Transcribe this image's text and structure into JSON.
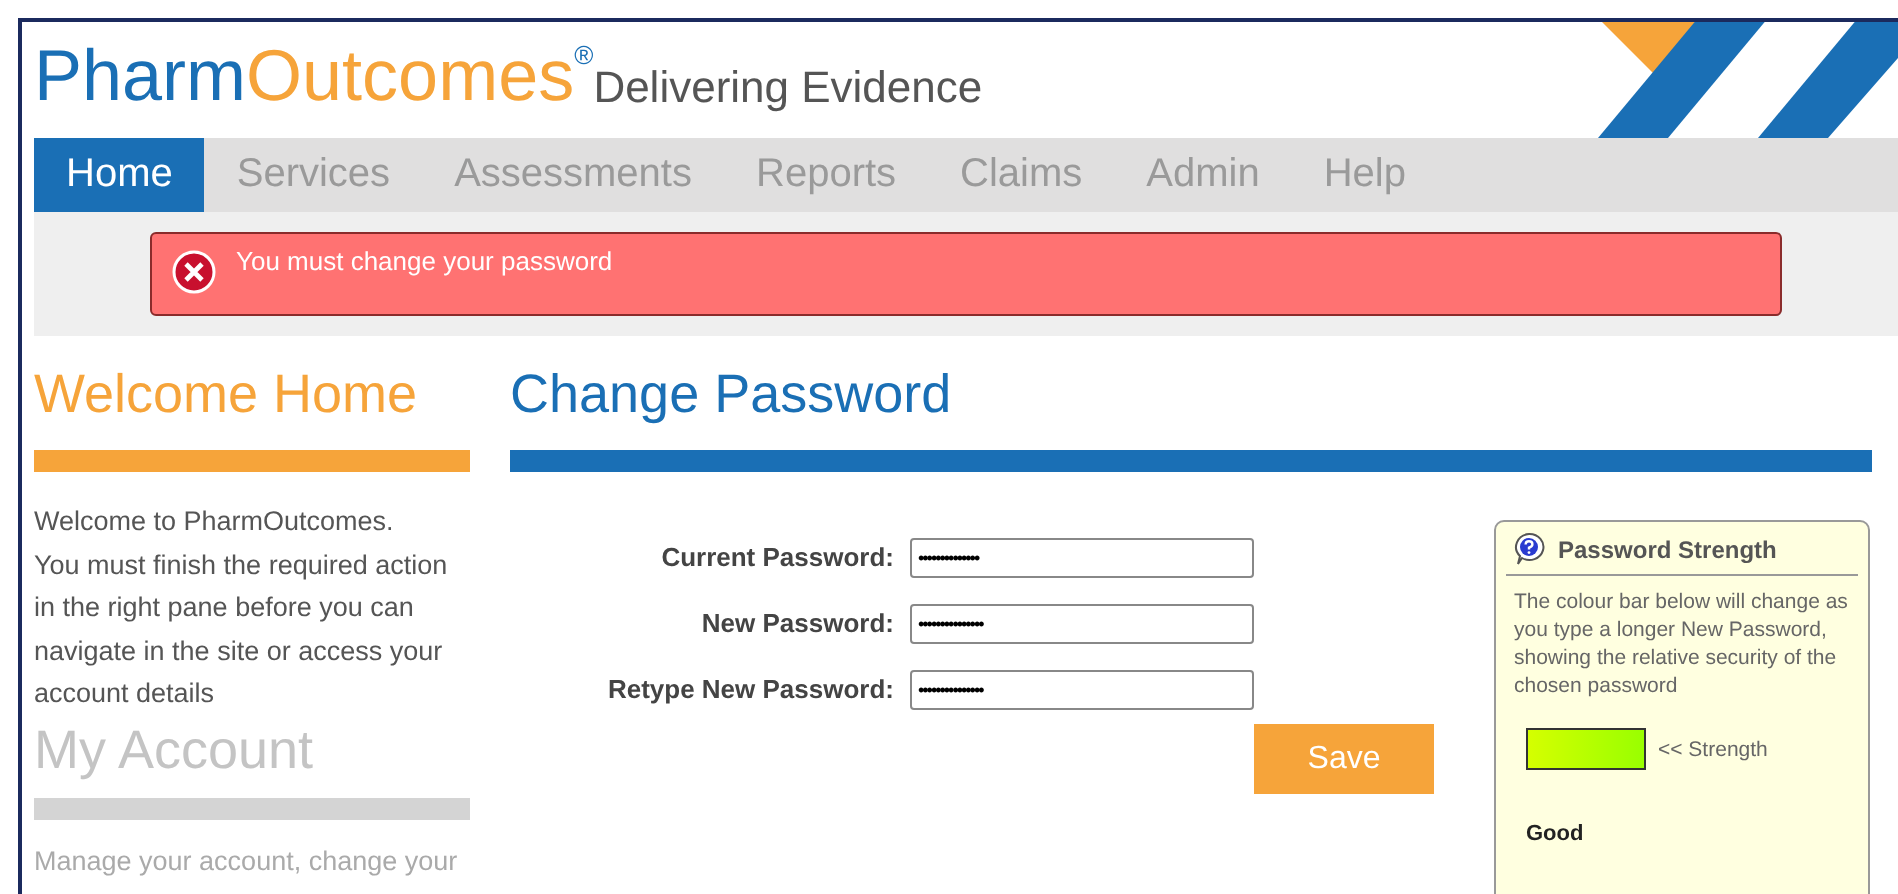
{
  "logo": {
    "name_first": "Pharm",
    "name_second": "Outcomes",
    "registered": "®",
    "tagline": "Delivering Evidence"
  },
  "nav": [
    {
      "label": "Home",
      "selected": true,
      "disabled": false
    },
    {
      "label": "Services",
      "selected": false,
      "disabled": true
    },
    {
      "label": "Assessments",
      "selected": false,
      "disabled": true
    },
    {
      "label": "Reports",
      "selected": false,
      "disabled": true
    },
    {
      "label": "Claims",
      "selected": false,
      "disabled": true
    },
    {
      "label": "Admin",
      "selected": false,
      "disabled": true
    },
    {
      "label": "Help",
      "selected": false,
      "disabled": true
    }
  ],
  "alert": {
    "message": "You must change your password"
  },
  "sidebar": [
    {
      "title": "Welcome Home",
      "disabled": false,
      "text": [
        "Welcome to PharmOutcomes.",
        "You must finish the required action in the right pane before you can navigate in the site or access your account details"
      ]
    },
    {
      "title": "My Account",
      "disabled": true,
      "text": [
        "Manage your account, change your"
      ]
    }
  ],
  "main": {
    "title": "Change Password",
    "fields": [
      {
        "label": "Current Password:",
        "value": "••••••••••••••"
      },
      {
        "label": "New Password:",
        "value": "•••••••••••••••"
      },
      {
        "label": "Retype New Password:",
        "value": "•••••••••••••••"
      }
    ],
    "save_button": "Save"
  },
  "strength": {
    "title": "Password Strength",
    "description": "The colour bar below will change as you type a longer New Password, showing the relative security of the chosen password",
    "level": 1,
    "bar_label": "<< Strength",
    "rating": "Good"
  }
}
